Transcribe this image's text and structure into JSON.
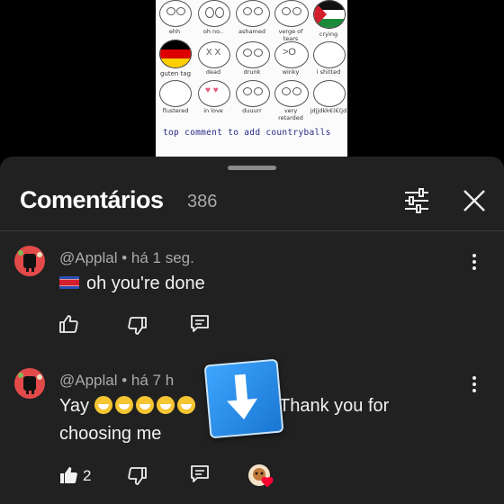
{
  "video": {
    "faces": [
      {
        "label": "ehh"
      },
      {
        "label": "oh no.."
      },
      {
        "label": "ashamed"
      },
      {
        "label": "verge of tears"
      },
      {
        "label": "crying"
      },
      {
        "label": "guten tag"
      },
      {
        "label": "dead"
      },
      {
        "label": "drunk"
      },
      {
        "label": "winky"
      },
      {
        "label": "i shitted"
      },
      {
        "label": "flustered"
      },
      {
        "label": "in love"
      },
      {
        "label": "duuurr"
      },
      {
        "label": "very retarded"
      },
      {
        "label": "jdjjdkk€(€(jd"
      }
    ],
    "banner": "top comment to add countryballs"
  },
  "header": {
    "title": "Comentários",
    "count": "386",
    "filter_icon": "sliders-icon",
    "close_icon": "close-icon"
  },
  "comments": [
    {
      "author": "@Applal • há 1 seg.",
      "flag": "north-korea-flag",
      "text": "oh you're done",
      "likes": ""
    },
    {
      "author": "@Applal • há 7 h",
      "text_start": "Yay",
      "emoji_count": 5,
      "text_end": "Thank you for",
      "text_line2": "choosing me",
      "likes": "2",
      "creator_heart": true
    }
  ],
  "colors": {
    "sheet_bg": "#212121",
    "text": "#f1f1f1",
    "muted": "#aaaaaa",
    "heart": "#ff0033",
    "download_icon": "#3ea6ff"
  }
}
